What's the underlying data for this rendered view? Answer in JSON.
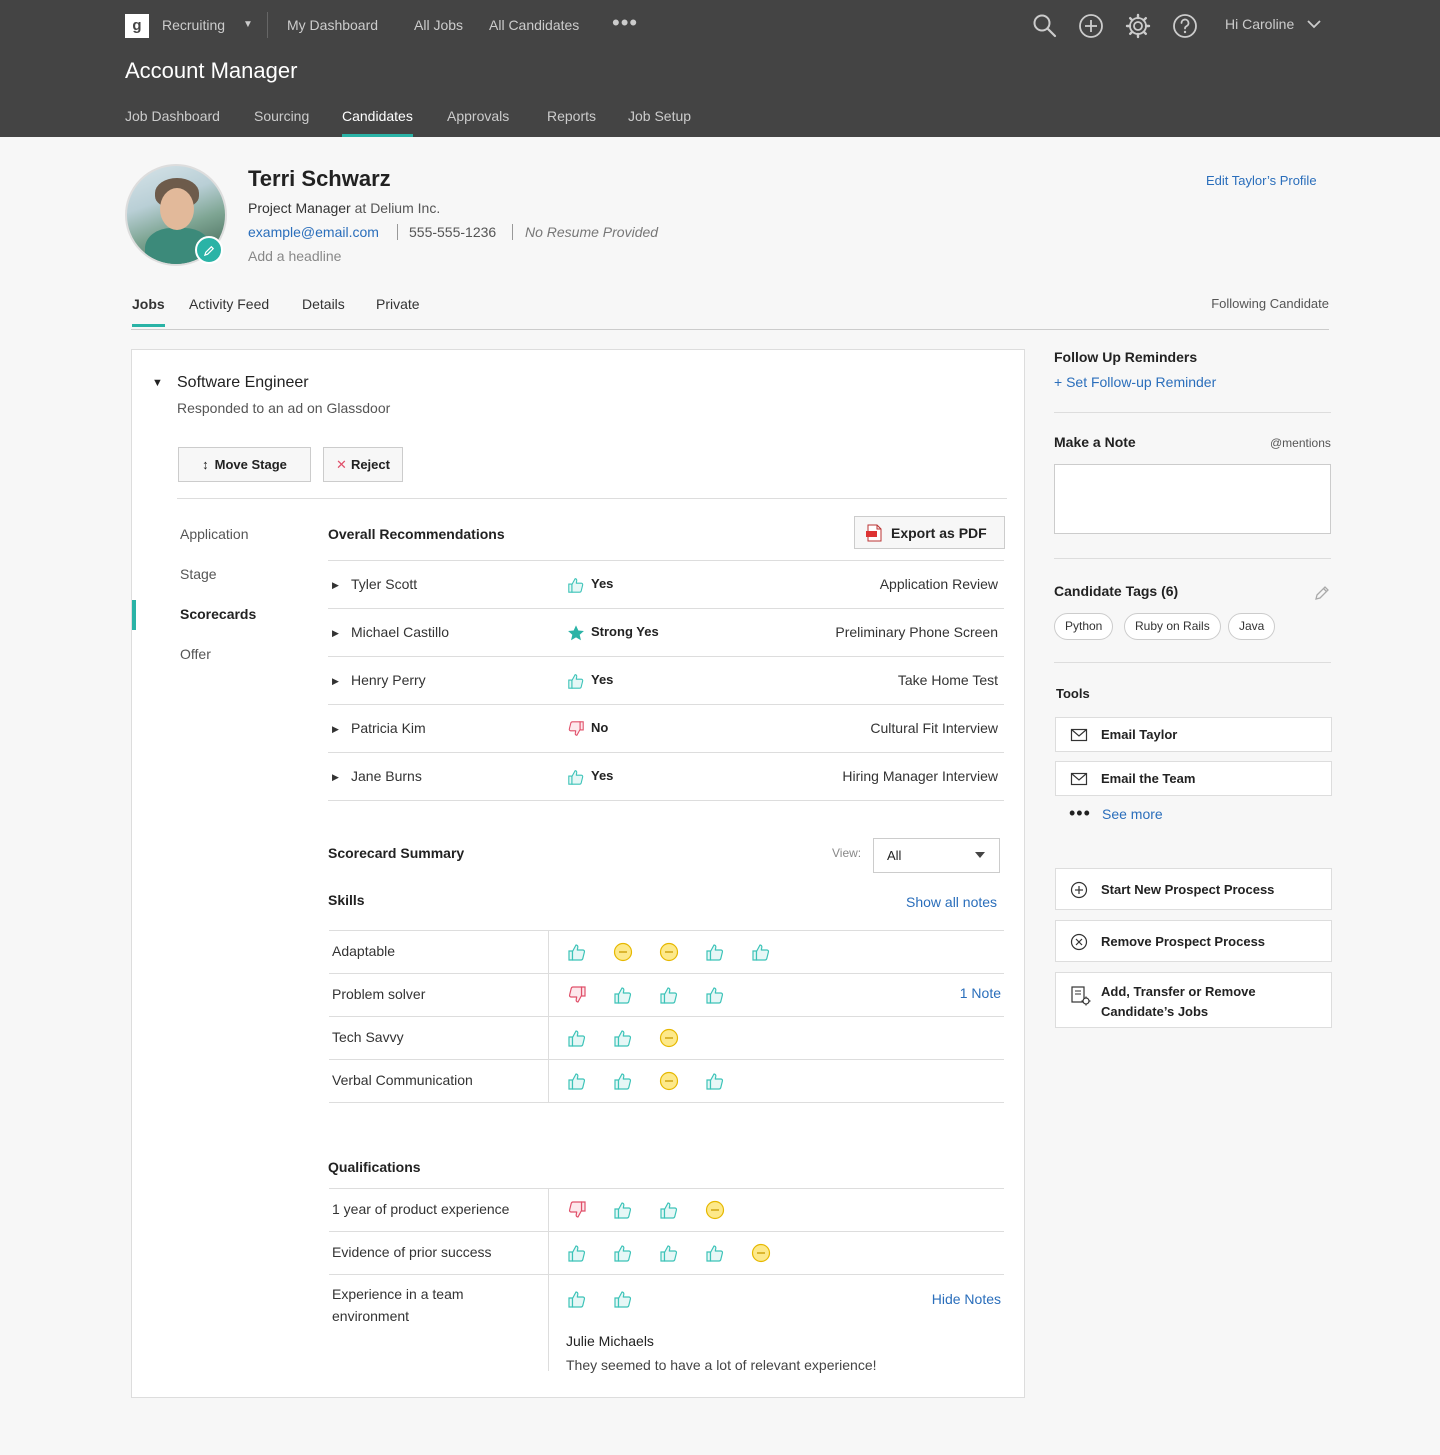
{
  "topbar": {
    "logo": "g",
    "app_name": "Recruiting",
    "nav": [
      "My Dashboard",
      "All Jobs",
      "All Candidates"
    ],
    "more_label": "•••",
    "greeting": "Hi Caroline",
    "page_title": "Account Manager",
    "subnav": [
      "Job Dashboard",
      "Sourcing",
      "Candidates",
      "Approvals",
      "Reports",
      "Job Setup"
    ],
    "subnav_active": "Candidates"
  },
  "candidate": {
    "name": "Terri Schwarz",
    "role": "Project Manager",
    "at": " at ",
    "company": "Delium Inc.",
    "email": "example@email.com",
    "phone": "555-555-1236",
    "resume": "No Resume Provided",
    "headline": "Add a headline",
    "edit_profile": "Edit Taylor’s Profile"
  },
  "profile_tabs": [
    "Jobs",
    "Activity Feed",
    "Details",
    "Private"
  ],
  "following": "Following Candidate",
  "job": {
    "title": "Software Engineer",
    "source": "Responded to an ad on Glassdoor",
    "move_stage": "Move Stage",
    "reject": "Reject",
    "side_nav": [
      "Application",
      "Stage",
      "Scorecards",
      "Offer"
    ],
    "side_active": "Scorecards"
  },
  "recommendations": {
    "title": "Overall Recommendations",
    "export": "Export as PDF",
    "rows": [
      {
        "name": "Tyler Scott",
        "vote": "Yes",
        "icon": "thumbs-up",
        "stage": "Application Review"
      },
      {
        "name": "Michael Castillo",
        "vote": "Strong Yes",
        "icon": "star",
        "stage": "Preliminary Phone Screen"
      },
      {
        "name": "Henry Perry",
        "vote": "Yes",
        "icon": "thumbs-up",
        "stage": "Take Home Test"
      },
      {
        "name": "Patricia Kim",
        "vote": "No",
        "icon": "thumbs-down",
        "stage": "Cultural Fit Interview"
      },
      {
        "name": "Jane Burns",
        "vote": "Yes",
        "icon": "thumbs-up",
        "stage": "Hiring Manager Interview"
      }
    ]
  },
  "summary": {
    "title": "Scorecard Summary",
    "view_label": "View:",
    "view_value": "All",
    "skills_title": "Skills",
    "show_all_notes": "Show all notes",
    "skills": [
      {
        "label": "Adaptable",
        "ratings": [
          "up",
          "neutral",
          "neutral",
          "up",
          "up"
        ],
        "note": ""
      },
      {
        "label": "Problem solver",
        "ratings": [
          "down",
          "up",
          "up",
          "up"
        ],
        "note": "1 Note"
      },
      {
        "label": "Tech Savvy",
        "ratings": [
          "up",
          "up",
          "neutral"
        ],
        "note": ""
      },
      {
        "label": "Verbal Communication",
        "ratings": [
          "up",
          "up",
          "neutral",
          "up"
        ],
        "note": ""
      }
    ],
    "qual_title": "Qualifications",
    "qualifications": [
      {
        "label": "1 year of product experience",
        "ratings": [
          "down",
          "up",
          "up",
          "neutral"
        ],
        "note": ""
      },
      {
        "label": "Evidence of prior success",
        "ratings": [
          "up",
          "up",
          "up",
          "up",
          "neutral"
        ],
        "note": ""
      },
      {
        "label_lines": [
          "Experience in a team",
          "environment"
        ],
        "ratings": [
          "up",
          "up"
        ],
        "note": "Hide Notes"
      }
    ],
    "note_author": "Julie Michaels",
    "note_text": "They seemed to have a lot of relevant experience!"
  },
  "right": {
    "reminders_title": "Follow Up Reminders",
    "set_reminder": "+ Set Follow-up Reminder",
    "note_title": "Make a Note",
    "mentions": "@mentions",
    "tags_title": "Candidate Tags (6)",
    "tags": [
      "Python",
      "Ruby on Rails",
      "Java"
    ],
    "tools_title": "Tools",
    "email_candidate": "Email Taylor",
    "email_team": "Email the Team",
    "see_more": "See more",
    "start_prospect": "Start New Prospect Process",
    "remove_prospect": "Remove Prospect Process",
    "transfer_lines": [
      "Add, Transfer or Remove",
      "Candidate’s Jobs"
    ]
  },
  "colors": {
    "topbar": "#444444",
    "accent": "#2ab3a6",
    "link": "#2a6ebb",
    "thumbs_up": "#3cc3b8",
    "thumbs_down": "#e0506a",
    "neutral": "#f3c623"
  }
}
